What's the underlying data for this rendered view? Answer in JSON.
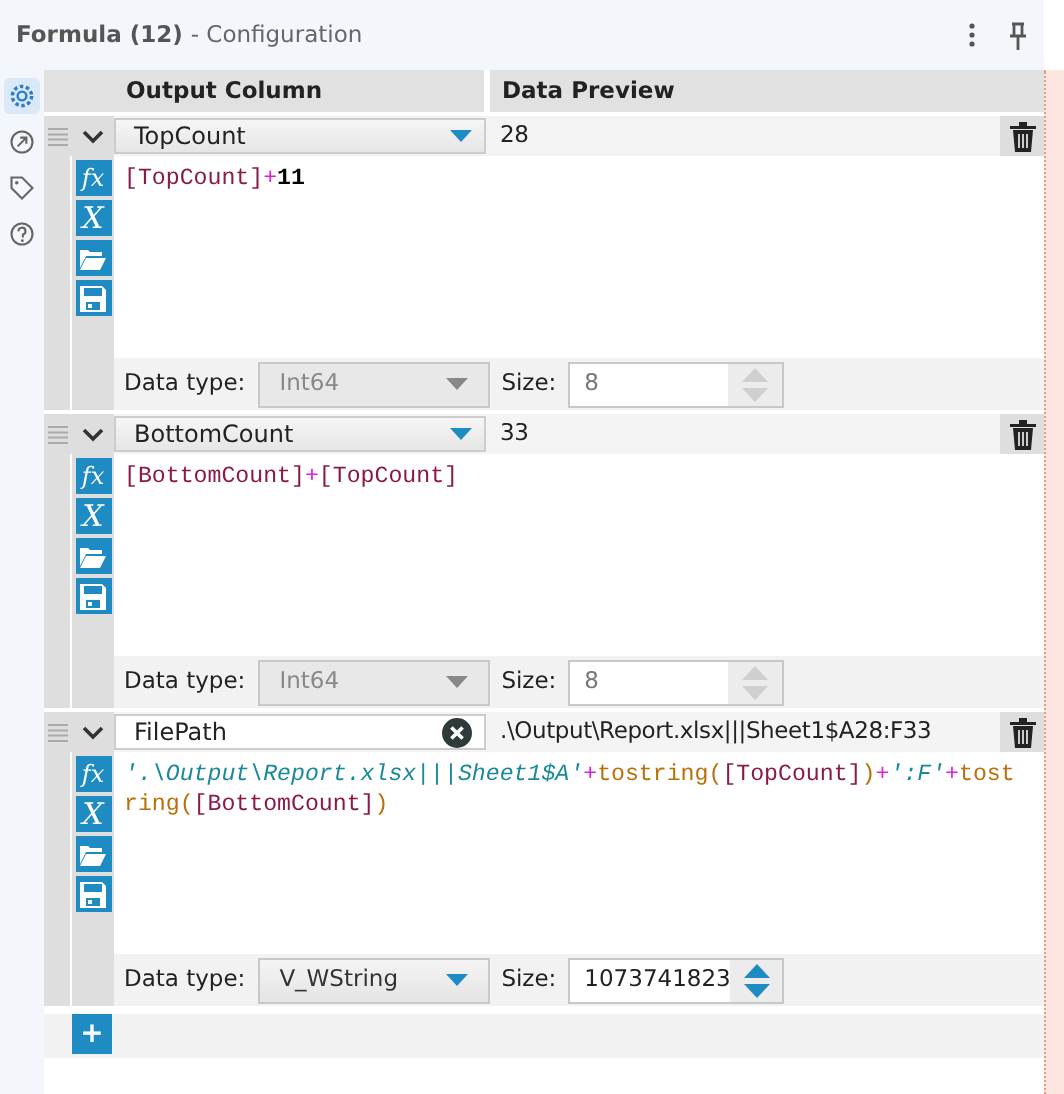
{
  "header": {
    "title": "Formula (12)",
    "subtitle": "- Configuration"
  },
  "sidebar": [
    {
      "kind": "gear",
      "selected": true
    },
    {
      "kind": "connection",
      "selected": false
    },
    {
      "kind": "tag",
      "selected": false
    },
    {
      "kind": "help",
      "selected": false
    }
  ],
  "columns": [
    "Output Column",
    "Data Preview"
  ],
  "formulas": [
    {
      "output_column": "TopCount",
      "editing": false,
      "preview": "28",
      "tools": [
        {
          "kind": "function",
          "label": "fx"
        },
        {
          "kind": "variable",
          "label": "X"
        },
        {
          "kind": "open"
        },
        {
          "kind": "save"
        }
      ],
      "expression": [
        {
          "kind": "field",
          "text": "[TopCount]"
        },
        {
          "kind": "operator",
          "text": "+"
        },
        {
          "kind": "number",
          "text": "11"
        }
      ],
      "data_type_label": "Data type:",
      "data_type": "Int64",
      "data_type_disabled": true,
      "size_label": "Size:",
      "size": "8",
      "size_disabled": true
    },
    {
      "output_column": "BottomCount",
      "editing": false,
      "preview": "33",
      "tools": [
        {
          "kind": "function",
          "label": "fx"
        },
        {
          "kind": "variable",
          "label": "X"
        },
        {
          "kind": "open"
        },
        {
          "kind": "save"
        }
      ],
      "expression": [
        {
          "kind": "field",
          "text": "[BottomCount]"
        },
        {
          "kind": "operator",
          "text": "+"
        },
        {
          "kind": "field",
          "text": "[TopCount]"
        }
      ],
      "data_type_label": "Data type:",
      "data_type": "Int64",
      "data_type_disabled": true,
      "size_label": "Size:",
      "size": "8",
      "size_disabled": true
    },
    {
      "output_column": "FilePath",
      "editing": true,
      "preview": ".\\Output\\Report.xlsx|||Sheet1$A28:F33",
      "tools": [
        {
          "kind": "function",
          "label": "fx"
        },
        {
          "kind": "variable",
          "label": "X"
        },
        {
          "kind": "open"
        },
        {
          "kind": "save"
        }
      ],
      "expression": [
        {
          "kind": "string",
          "text": "'.\\Output\\Report.xlsx|||Sheet1$A'"
        },
        {
          "kind": "operator",
          "text": "+"
        },
        {
          "kind": "function",
          "text": "tostring("
        },
        {
          "kind": "field",
          "text": "[TopCount]"
        },
        {
          "kind": "function",
          "text": ")"
        },
        {
          "kind": "operator",
          "text": "+"
        },
        {
          "kind": "string",
          "text": "':F'"
        },
        {
          "kind": "operator",
          "text": "+"
        },
        {
          "kind": "function",
          "text": "tostring("
        },
        {
          "kind": "field",
          "text": "[BottomCount]"
        },
        {
          "kind": "function",
          "text": ")"
        }
      ],
      "data_type_label": "Data type:",
      "data_type": "V_WString",
      "data_type_disabled": false,
      "size_label": "Size:",
      "size": "1073741823",
      "size_disabled": false
    }
  ],
  "add_button": {
    "label": "+"
  }
}
